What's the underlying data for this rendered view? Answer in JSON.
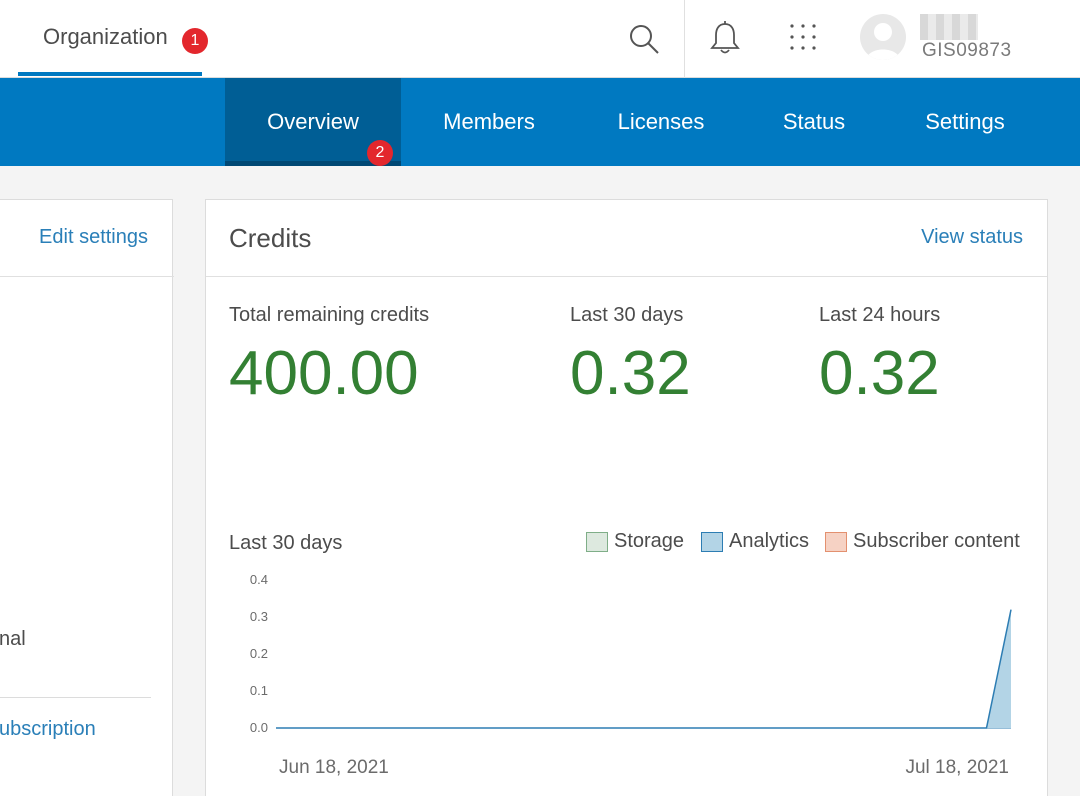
{
  "header": {
    "org_tab_label": "Organization",
    "org_badge": "1",
    "username": "GIS09873"
  },
  "nav": {
    "items": [
      {
        "label": "Overview",
        "active": true
      },
      {
        "label": "Members",
        "active": false
      },
      {
        "label": "Licenses",
        "active": false
      },
      {
        "label": "Status",
        "active": false
      },
      {
        "label": "Settings",
        "active": false
      }
    ],
    "badge": "2"
  },
  "left_panel": {
    "edit_settings": "Edit settings",
    "partial_text": "nal",
    "partial_link": "ubscription"
  },
  "credits": {
    "title": "Credits",
    "view_status": "View status",
    "stats": [
      {
        "label": "Total remaining credits",
        "value": "400.00"
      },
      {
        "label": "Last 30 days",
        "value": "0.32"
      },
      {
        "label": "Last 24 hours",
        "value": "0.32"
      }
    ],
    "chart_section_label": "Last 30 days",
    "legend": [
      {
        "label": "Storage",
        "fill": "#dde9df",
        "stroke": "#7fae88"
      },
      {
        "label": "Analytics",
        "fill": "#b3d4e6",
        "stroke": "#2d7db3"
      },
      {
        "label": "Subscriber content",
        "fill": "#f6d2c4",
        "stroke": "#e3906f"
      }
    ]
  },
  "colors": {
    "accent_blue": "#0079c1",
    "value_green": "#338033",
    "link_blue": "#2a7fb8",
    "badge_red": "#e3272d"
  },
  "chart_data": {
    "type": "area",
    "x_tick_labels": [
      "Jun 18, 2021",
      "Jul 18, 2021"
    ],
    "y_ticks": [
      "0.4",
      "0.3",
      "0.2",
      "0.1",
      "0.0"
    ],
    "ylim": [
      0,
      0.4
    ],
    "x_start": "2021-06-18",
    "x_end": "2021-07-18",
    "series": [
      {
        "name": "Analytics",
        "points": [
          {
            "x": "2021-06-18",
            "y": 0.0
          },
          {
            "x": "2021-07-17",
            "y": 0.0
          },
          {
            "x": "2021-07-18",
            "y": 0.32
          }
        ]
      }
    ]
  }
}
